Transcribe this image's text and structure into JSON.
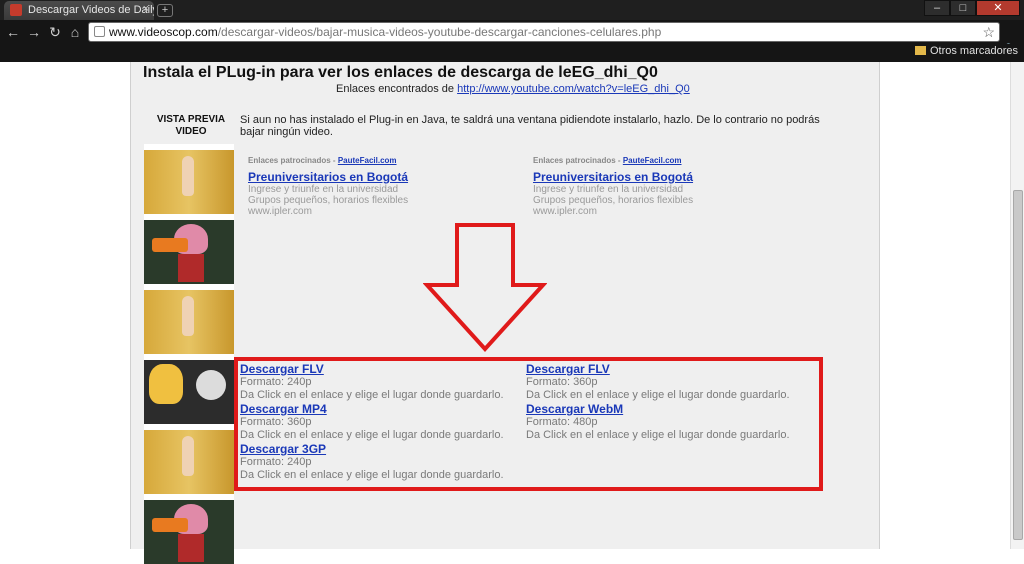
{
  "browser": {
    "tab_title": "Descargar Videos de Dailym",
    "tab_close": "×",
    "new_tab": "+",
    "window_buttons": [
      "–",
      "□",
      "✕"
    ],
    "url_host": "www.videoscop.com",
    "url_path": "/descargar-videos/bajar-musica-videos-youtube-descargar-canciones-celulares.php",
    "bookmarks_label": "Otros marcadores",
    "icons": {
      "back": "←",
      "forward": "→",
      "reload": "↻",
      "home": "⌂",
      "star": "☆",
      "wrench": "🔧"
    }
  },
  "page": {
    "title": "Instala el PLug-in para ver los enlaces de descarga de leEG_dhi_Q0",
    "found_prefix": "Enlaces encontrados de",
    "found_link": "http://www.youtube.com/watch?v=leEG_dhi_Q0",
    "preview_label": "VISTA PREVIA VIDEO",
    "intro": "Si aun no has instalado el Plug-in en Java, te saldrá una ventana pidiendote instalarlo, hazlo. De lo contrario no podrás bajar ningún video."
  },
  "ads": [
    {
      "head_prefix": "Enlaces patrocinados -",
      "head_link": "PauteFacil.com",
      "title": "Preuniversitarios en Bogotá",
      "line1": "Ingrese y triunfe en la universidad",
      "line2": "Grupos pequeños, horarios flexibles",
      "line3": "www.ipler.com"
    },
    {
      "head_prefix": "Enlaces patrocinados -",
      "head_link": "PauteFacil.com",
      "title": "Preuniversitarios en Bogotá",
      "line1": "Ingrese y triunfe en la universidad",
      "line2": "Grupos pequeños, horarios flexibles",
      "line3": "www.ipler.com"
    }
  ],
  "downloads": [
    {
      "link": "Descargar FLV",
      "format": "Formato: 240p",
      "hint": "Da Click en el enlace y elige el lugar donde guardarlo."
    },
    {
      "link": "Descargar FLV",
      "format": "Formato: 360p",
      "hint": "Da Click en el enlace y elige el lugar donde guardarlo."
    },
    {
      "link": "Descargar MP4",
      "format": "Formato: 360p",
      "hint": "Da Click en el enlace y elige el lugar donde guardarlo."
    },
    {
      "link": "Descargar WebM",
      "format": "Formato: 480p",
      "hint": "Da Click en el enlace y elige el lugar donde guardarlo."
    },
    {
      "link": "Descargar 3GP",
      "format": "Formato: 240p",
      "hint": "Da Click en el enlace y elige el lugar donde guardarlo."
    }
  ],
  "colors": {
    "link": "#1a38b8",
    "highlight": "#e01a1a"
  }
}
